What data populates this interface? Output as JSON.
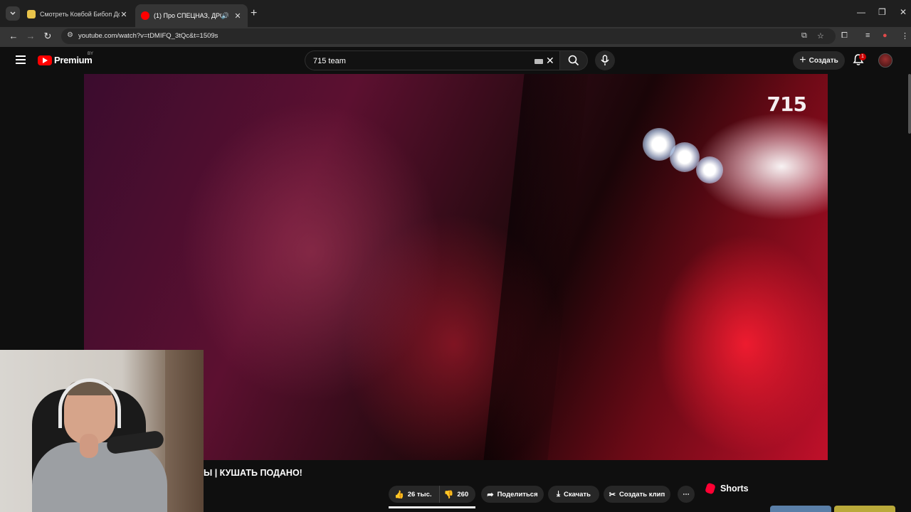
{
  "browser": {
    "tabs": [
      {
        "title": "Смотреть Ковбой Бибоп Дос",
        "favicon_color": "#e8c34a",
        "active": false
      },
      {
        "title": "(1) Про СПЕЦНАЗ, ДРОНЫ",
        "favicon_color": "#ff0000",
        "active": true
      }
    ],
    "new_tab_label": "+",
    "url": "youtube.com/watch?v=tDMIFQ_3tQc&t=1509s"
  },
  "youtube": {
    "logo_text": "Premium",
    "logo_region": "BY",
    "search_value": "715 team",
    "create_label": "Создать",
    "notification_count": "1"
  },
  "video": {
    "watermark": "715",
    "title": "Ы | КУШАТЬ ПОДАНО!"
  },
  "actions": {
    "likes": "26 тыс.",
    "dislikes": "260",
    "share": "Поделиться",
    "download": "Скачать",
    "clip": "Создать клип"
  },
  "sidebar": {
    "shorts_label": "Shorts"
  },
  "colors": {
    "accent": "#ff0000",
    "background": "#0f0f0f",
    "pill": "#272727"
  }
}
